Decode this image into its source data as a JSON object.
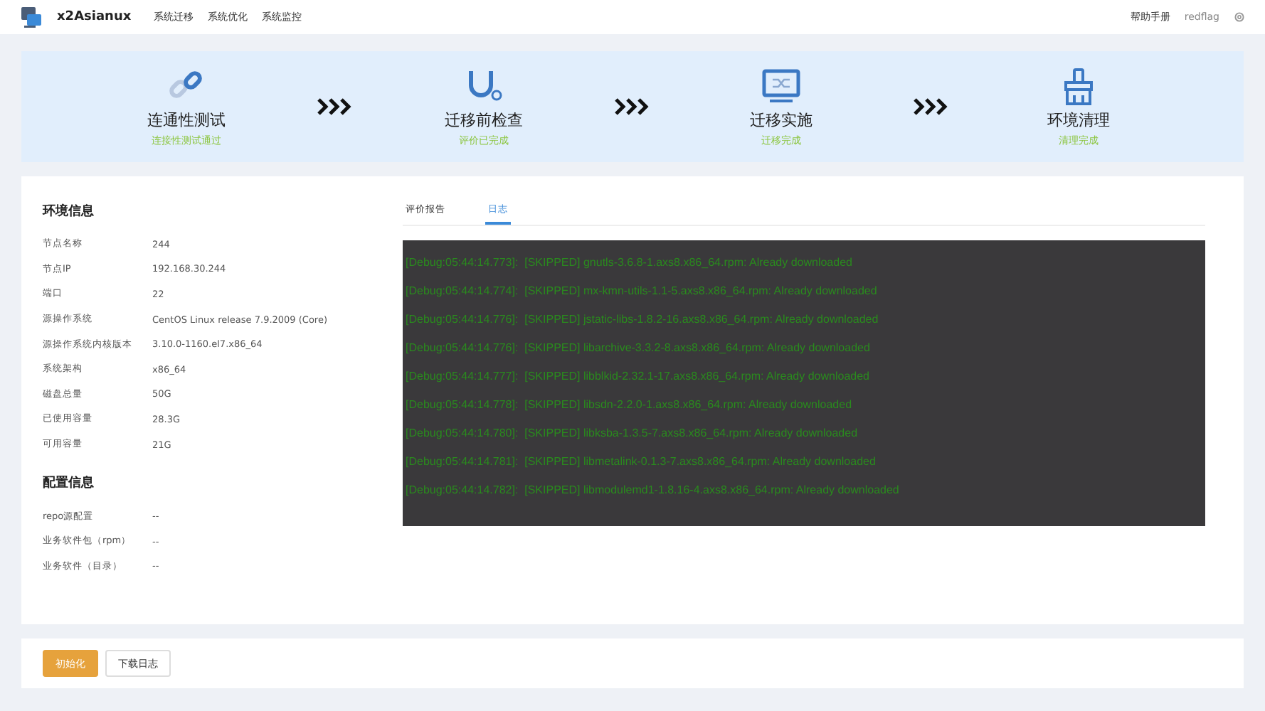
{
  "header": {
    "brand": "x2Asianux",
    "nav": [
      "系统迁移",
      "系统优化",
      "系统监控"
    ],
    "help": "帮助手册",
    "user": "redflag"
  },
  "steps": [
    {
      "kind": "link",
      "title": "连通性测试",
      "status": "连接性测试通过"
    },
    {
      "kind": "magnet",
      "title": "迁移前检查",
      "status": "评价已完成"
    },
    {
      "kind": "monitor",
      "title": "迁移实施",
      "status": "迁移完成"
    },
    {
      "kind": "brush",
      "title": "环境清理",
      "status": "清理完成"
    }
  ],
  "env": {
    "title": "环境信息",
    "rows": [
      {
        "label": "节点名称",
        "value": "244"
      },
      {
        "label": "节点IP",
        "value": "192.168.30.244"
      },
      {
        "label": "端口",
        "value": "22"
      },
      {
        "label": "源操作系统",
        "value": "CentOS Linux release 7.9.2009 (Core)"
      },
      {
        "label": "源操作系统内核版本",
        "value": "3.10.0-1160.el7.x86_64"
      },
      {
        "label": "系统架构",
        "value": "x86_64"
      },
      {
        "label": "磁盘总量",
        "value": "50G"
      },
      {
        "label": "已使用容量",
        "value": "28.3G"
      },
      {
        "label": "可用容量",
        "value": "21G"
      }
    ]
  },
  "config": {
    "title": "配置信息",
    "rows": [
      {
        "label": "repo源配置",
        "value": "--"
      },
      {
        "label": "业务软件包（rpm）",
        "value": "--"
      },
      {
        "label": "业务软件（目录）",
        "value": "--"
      }
    ]
  },
  "tabs": [
    {
      "label": "评价报告",
      "selected": false
    },
    {
      "label": "日志",
      "selected": true
    }
  ],
  "log": [
    "[Debug:05:44:14.773]:  [SKIPPED] gnutls-3.6.8-1.axs8.x86_64.rpm: Already downloaded",
    "[Debug:05:44:14.774]:  [SKIPPED] mx-kmn-utils-1.1-5.axs8.x86_64.rpm: Already downloaded",
    "[Debug:05:44:14.776]:  [SKIPPED] jstatic-libs-1.8.2-16.axs8.x86_64.rpm: Already downloaded",
    "[Debug:05:44:14.776]:  [SKIPPED] libarchive-3.3.2-8.axs8.x86_64.rpm: Already downloaded",
    "[Debug:05:44:14.777]:  [SKIPPED] libblkid-2.32.1-17.axs8.x86_64.rpm: Already downloaded",
    "[Debug:05:44:14.778]:  [SKIPPED] libsdn-2.2.0-1.axs8.x86_64.rpm: Already downloaded",
    "[Debug:05:44:14.780]:  [SKIPPED] libksba-1.3.5-7.axs8.x86_64.rpm: Already downloaded",
    "[Debug:05:44:14.781]:  [SKIPPED] libmetalink-0.1.3-7.axs8.x86_64.rpm: Already downloaded",
    "[Debug:05:44:14.782]:  [SKIPPED] libmodulemd1-1.8.16-4.axs8.x86_64.rpm: Already downloaded"
  ],
  "buttons": [
    {
      "kind": "primary",
      "label": "初始化"
    },
    {
      "kind": "default",
      "label": "下载日志"
    }
  ]
}
